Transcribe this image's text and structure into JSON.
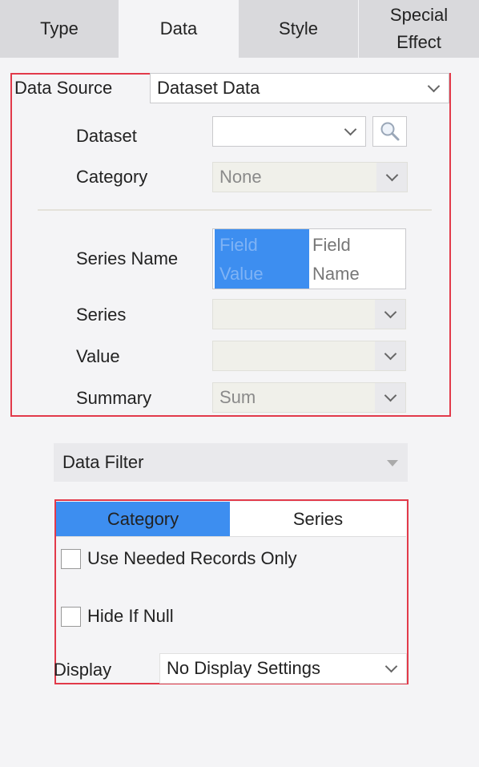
{
  "tabs": [
    {
      "label": "Type"
    },
    {
      "label": "Data"
    },
    {
      "label": "Style"
    },
    {
      "label": "Special Effect"
    }
  ],
  "active_tab": "Data",
  "data_source": {
    "label": "Data Source",
    "value": "Dataset Data",
    "dataset_label": "Dataset",
    "dataset_value": "",
    "category_label": "Category",
    "category_value": "None",
    "series_name_label": "Series Name",
    "series_name_options": [
      "Field Value",
      "Field Name"
    ],
    "series_name_selected": "Field Value",
    "series_label": "Series",
    "series_value": "",
    "value_label": "Value",
    "value_value": "",
    "summary_label": "Summary",
    "summary_value": "Sum"
  },
  "data_filter": {
    "label": "Data Filter",
    "tabs": [
      "Category",
      "Series"
    ],
    "active_tab": "Category",
    "use_needed_label": "Use Needed Records Only",
    "use_needed_checked": false,
    "hide_null_label": "Hide If Null",
    "hide_null_checked": false,
    "display_label": "Display",
    "display_value": "No Display Settings"
  },
  "colors": {
    "accent": "#3d8ef0",
    "highlight_border": "#e23a4a",
    "tab_bg": "#d9d9dc",
    "panel_bg": "#f4f4f6"
  }
}
